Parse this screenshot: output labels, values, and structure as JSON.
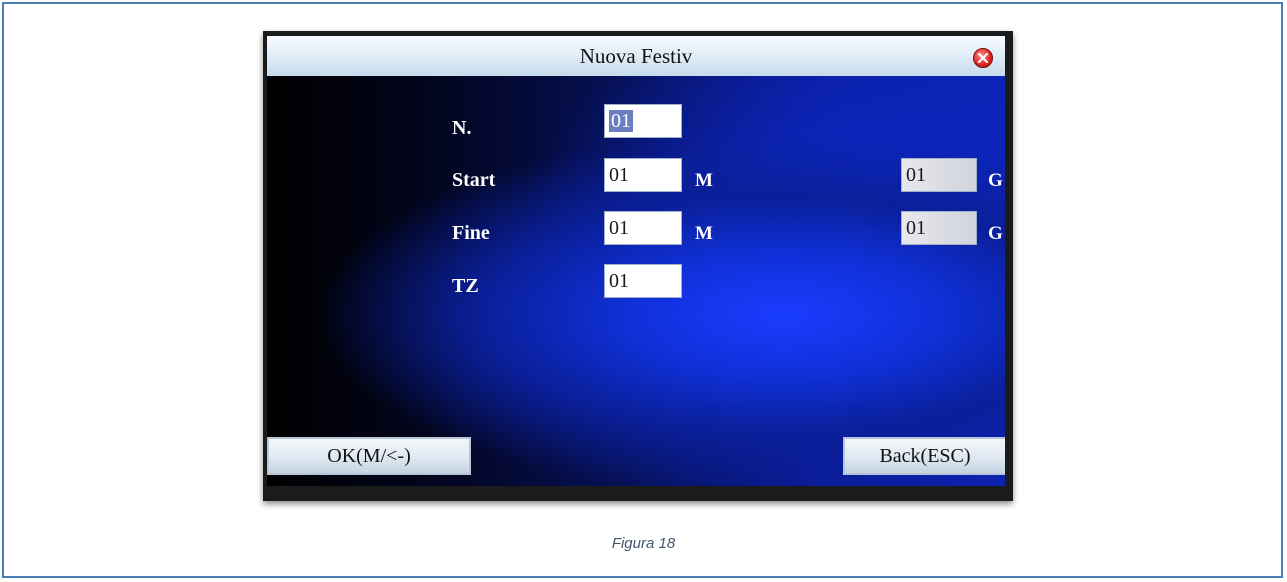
{
  "dialog": {
    "title": "Nuova Festiv",
    "close_icon": "close-icon"
  },
  "fields": {
    "number": {
      "label": "N.",
      "value": "01"
    },
    "start": {
      "label": "Start",
      "month_value": "01",
      "month_unit": "M",
      "day_value": "01",
      "day_unit": "G"
    },
    "end": {
      "label": "Fine",
      "month_value": "01",
      "month_unit": "M",
      "day_value": "01",
      "day_unit": "G"
    },
    "tz": {
      "label": "TZ",
      "value": "01"
    }
  },
  "softkeys": {
    "ok": "OK(M/<-)",
    "back": "Back(ESC)"
  },
  "caption": "Figura 18",
  "colors": {
    "frame_border": "#4a7fb5",
    "screen_blue": "#1030d8",
    "close_red": "#e02a2a",
    "caption": "#44546a"
  }
}
